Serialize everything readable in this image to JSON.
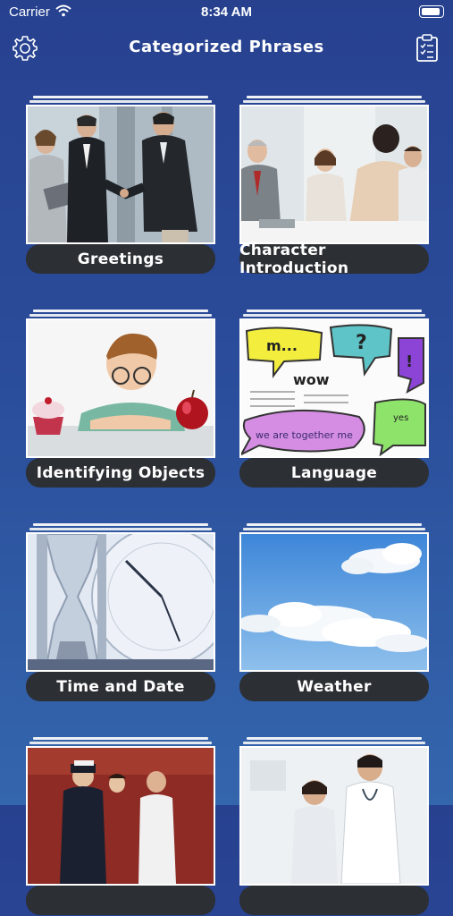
{
  "status_bar": {
    "carrier": "Carrier",
    "time": "8:34 AM"
  },
  "navbar": {
    "title": "Categorized Phrases",
    "left_icon": "gear-icon",
    "right_icon": "clipboard-icon"
  },
  "categories": [
    {
      "label": "Greetings"
    },
    {
      "label": "Character Introduction"
    },
    {
      "label": "Identifying Objects"
    },
    {
      "label": "Language"
    },
    {
      "label": "Time and Date"
    },
    {
      "label": "Weather"
    },
    {
      "label": ""
    },
    {
      "label": ""
    }
  ],
  "language_image_text": {
    "bubble1": "m...",
    "bubble2": "?",
    "bubble3": "wow",
    "bubble4": "!",
    "bubble5": "we are together me",
    "bubble6": "yes"
  },
  "colors": {
    "background_top": "#27418f",
    "background_bottom": "#3466ad",
    "label_bg": "#2c2f33"
  }
}
